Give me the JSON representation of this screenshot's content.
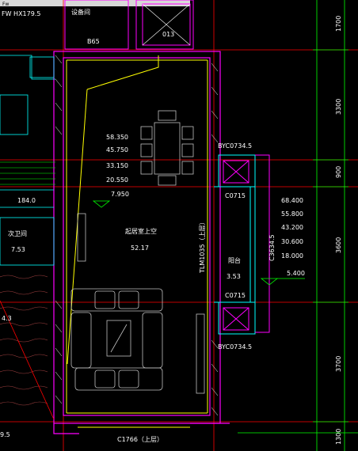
{
  "title_tab": "Fw",
  "top_labels": {
    "left_text": "FW HX179.5",
    "stair_label": "B65",
    "corridor_label": "设备间",
    "shaft_label": "013"
  },
  "levels": [
    "58.350",
    "45.750",
    "33.150",
    "20.550",
    "7.950"
  ],
  "room_main": {
    "name": "起居室上空",
    "area": "52.17"
  },
  "left_rooms": {
    "stair_level": "184.0",
    "bath_name": "次卫间",
    "bath_area": "7.53"
  },
  "vertical_text": "TLM1035（上层）",
  "windows": {
    "top_tag": "BYC0734.5",
    "c1": "C0715",
    "c2": "C0715",
    "bottom_tag": "BYC0734.5",
    "side_tag": "C3634.5",
    "bottom_window": "C1766（上层）"
  },
  "balcony": {
    "name": "阳台",
    "area": "3.53",
    "level_right": "5.400"
  },
  "right_levels": [
    "68.400",
    "55.800",
    "43.200",
    "30.600",
    "18.000"
  ],
  "right_dims": [
    "1700",
    "3300",
    "900",
    "3600",
    "3700",
    "1300"
  ],
  "left_bottom_labels": [
    "9.5",
    "4.3"
  ],
  "colors": {
    "wall": "#ff00ff",
    "window": "#00ffff",
    "axis": "#ff0000",
    "dim": "#00ff00",
    "yellow": "#ffff00",
    "furniture": "#c0c0c0"
  }
}
